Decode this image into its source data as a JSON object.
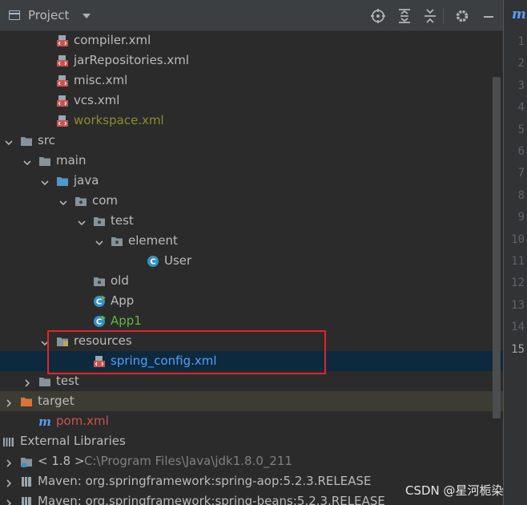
{
  "toolbar": {
    "title": "Project"
  },
  "tree": [
    {
      "label": "compiler.xml",
      "icon": "xml-file-icon",
      "arrow": "none",
      "color": "#bbbbbb"
    },
    {
      "label": "jarRepositories.xml",
      "icon": "xml-file-icon",
      "arrow": "none",
      "color": "#bbbbbb"
    },
    {
      "label": "misc.xml",
      "icon": "xml-file-icon",
      "arrow": "none",
      "color": "#bbbbbb"
    },
    {
      "label": "vcs.xml",
      "icon": "xml-file-icon",
      "arrow": "none",
      "color": "#bbbbbb"
    },
    {
      "label": "workspace.xml",
      "icon": "xml-file-icon",
      "arrow": "none",
      "color": "#8c8c2d"
    },
    {
      "label": "src",
      "icon": "folder-icon",
      "arrow": "expanded",
      "color": "#bbbbbb"
    },
    {
      "label": "main",
      "icon": "folder-icon",
      "arrow": "expanded",
      "color": "#bbbbbb"
    },
    {
      "label": "java",
      "icon": "source-folder-icon",
      "arrow": "expanded",
      "color": "#bbbbbb"
    },
    {
      "label": "com",
      "icon": "package-icon",
      "arrow": "expanded",
      "color": "#bbbbbb"
    },
    {
      "label": "test",
      "icon": "package-icon",
      "arrow": "expanded",
      "color": "#bbbbbb"
    },
    {
      "label": "element",
      "icon": "package-icon",
      "arrow": "expanded",
      "color": "#bbbbbb"
    },
    {
      "label": "User",
      "icon": "class-icon",
      "arrow": "none",
      "color": "#bbbbbb"
    },
    {
      "label": "old",
      "icon": "package-icon",
      "arrow": "none",
      "color": "#bbbbbb"
    },
    {
      "label": "App",
      "icon": "runnable-class-icon",
      "arrow": "none",
      "color": "#bbbbbb"
    },
    {
      "label": "App1",
      "icon": "runnable-class-icon",
      "arrow": "none",
      "color": "#62b543"
    },
    {
      "label": "resources",
      "icon": "resources-folder-icon",
      "arrow": "expanded",
      "color": "#bbbbbb"
    },
    {
      "label": "spring_config.xml",
      "icon": "xml-file-icon",
      "arrow": "none",
      "color": "#589df6"
    },
    {
      "label": "test",
      "icon": "folder-icon",
      "arrow": "collapsed",
      "color": "#bbbbbb"
    },
    {
      "label": "target",
      "icon": "excluded-folder-icon",
      "arrow": "collapsed",
      "color": "#bbbbbb"
    },
    {
      "label": "pom.xml",
      "icon": "maven-icon",
      "arrow": "none",
      "color": "#c75450"
    },
    {
      "label": "External Libraries",
      "icon": "libraries-icon",
      "arrow": "expanded",
      "color": "#bbbbbb"
    },
    {
      "label": "< 1.8 >",
      "hint": "C:\\Program Files\\Java\\jdk1.8.0_211",
      "icon": "jdk-icon",
      "arrow": "collapsed",
      "color": "#bbbbbb"
    },
    {
      "label": "Maven: org.springframework:spring-aop:5.2.3.RELEASE",
      "icon": "library-icon",
      "arrow": "collapsed",
      "color": "#bbbbbb"
    },
    {
      "label": "Maven: org.springframework:spring-beans:5.2.3.RELEASE",
      "icon": "library-icon",
      "arrow": "collapsed",
      "color": "#bbbbbb"
    }
  ],
  "gutter": {
    "tab": "m",
    "lines": [
      "1",
      "2",
      "3",
      "4",
      "5",
      "6",
      "7",
      "8",
      "9",
      "10",
      "11",
      "12",
      "13",
      "14",
      "15"
    ],
    "current": "15"
  },
  "watermark": "CSDN @星河栀染",
  "colors": {
    "selection": "#0d293e",
    "highlight_box": "#e0242c",
    "folder": "#87939a",
    "source_folder": "#4e9ac8",
    "excluded_folder": "#d87538",
    "xml_red": "#c75450",
    "class_blue": "#3592c4"
  }
}
